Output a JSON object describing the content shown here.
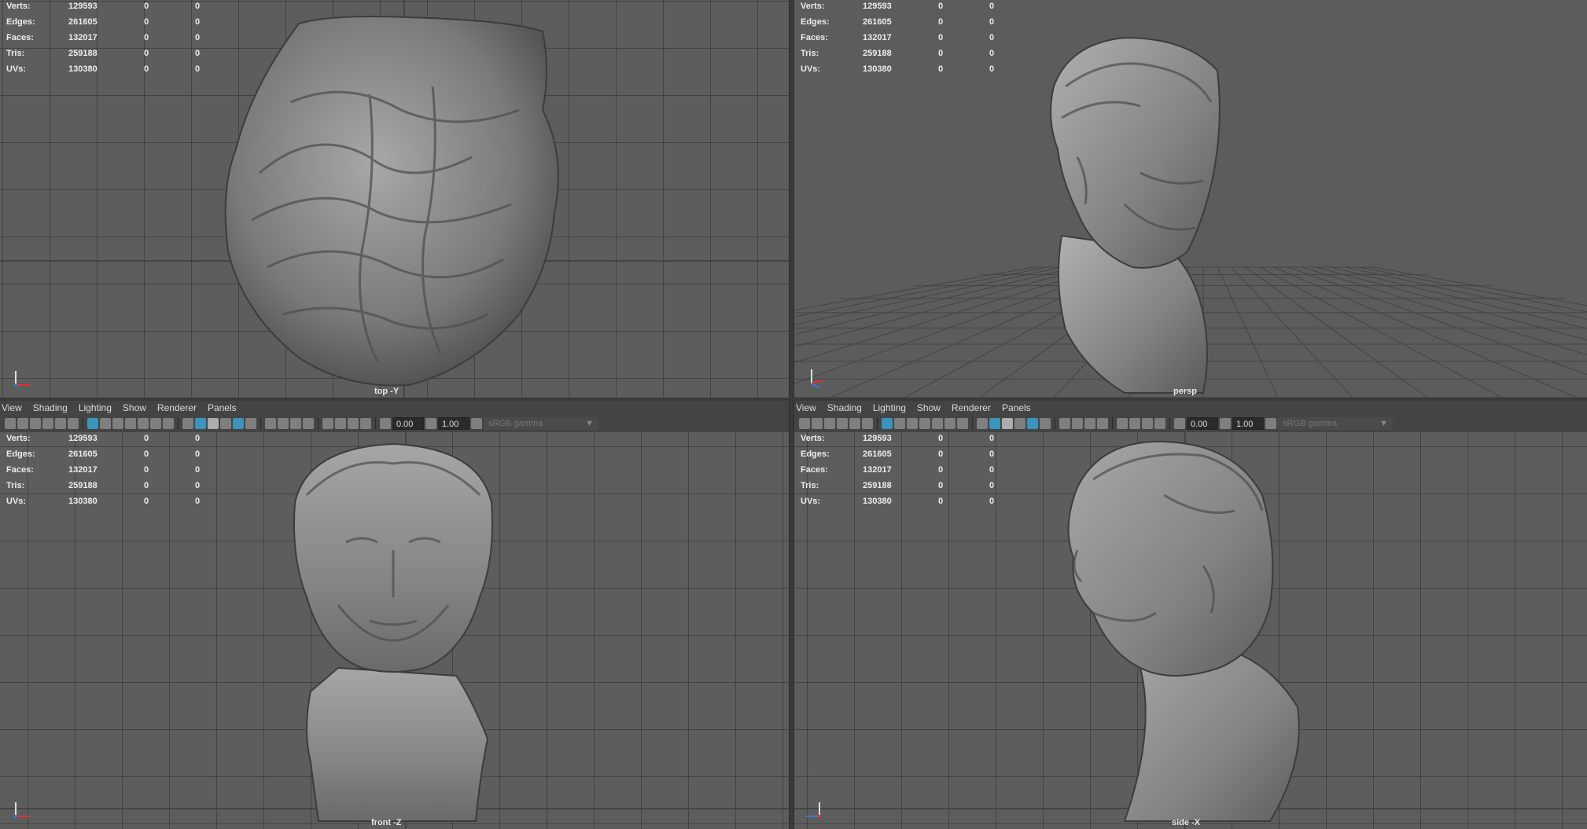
{
  "stats": {
    "rows": [
      {
        "label": "Verts:",
        "value": "129593",
        "sel": "0",
        "sel2": "0"
      },
      {
        "label": "Edges:",
        "value": "261605",
        "sel": "0",
        "sel2": "0"
      },
      {
        "label": "Faces:",
        "value": "132017",
        "sel": "0",
        "sel2": "0"
      },
      {
        "label": "Tris:",
        "value": "259188",
        "sel": "0",
        "sel2": "0"
      },
      {
        "label": "UVs:",
        "value": "130380",
        "sel": "0",
        "sel2": "0"
      }
    ]
  },
  "cameras": {
    "top": "top -Y",
    "persp": "persp",
    "front": "front -Z",
    "side": "side -X"
  },
  "panel_menu": {
    "items": [
      "View",
      "Shading",
      "Lighting",
      "Show",
      "Renderer",
      "Panels"
    ]
  },
  "toolbar": {
    "exposure": "0.00",
    "gamma": "1.00",
    "color_space": "sRGB gamma"
  },
  "colors": {
    "viewport_bg": "#5d5d5d",
    "accent": "#3aa2d0"
  }
}
